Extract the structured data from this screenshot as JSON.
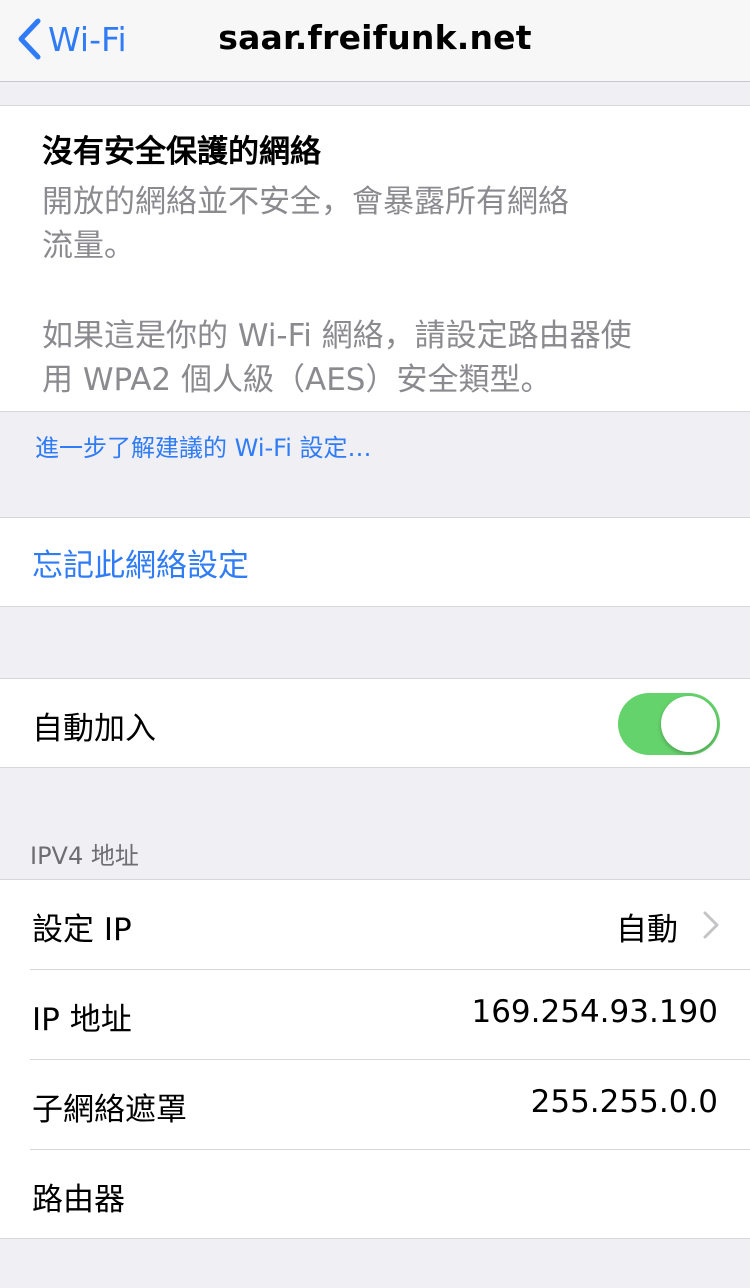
{
  "nav": {
    "back_label": "Wi-Fi",
    "title": "saar.freifunk.net"
  },
  "warning": {
    "title": "沒有安全保護的網絡",
    "body1_line1": "開放的網絡並不安全，會暴露所有網絡",
    "body1_line2": "流量。",
    "body2_line1": "如果這是你的 Wi-Fi 網絡，請設定路由器使",
    "body2_line2": "用 WPA2 個人級（AES）安全類型。"
  },
  "learn_more": "進一步了解建議的 Wi-Fi 設定…",
  "forget_network": "忘記此網絡設定",
  "auto_join": {
    "label": "自動加入",
    "enabled": true
  },
  "ipv4": {
    "header": "IPV4 地址",
    "rows": [
      {
        "label": "設定 IP",
        "value": "自動"
      },
      {
        "label": "IP 地址",
        "value": "169.254.93.190"
      },
      {
        "label": "子網絡遮罩",
        "value": "255.255.0.0"
      },
      {
        "label": "路由器",
        "value": ""
      }
    ]
  },
  "colors": {
    "accent": "#2f7cf6",
    "toggle_on": "#65d36b",
    "background": "#efeff4"
  }
}
